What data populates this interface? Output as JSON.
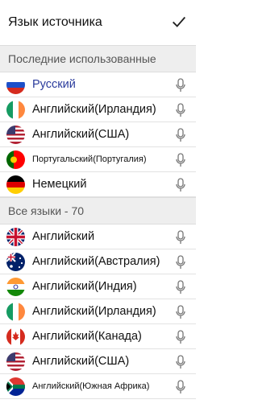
{
  "header": {
    "title": "Язык источника",
    "confirm_icon": "checkmark-icon"
  },
  "recent": {
    "heading": "Последние использованные",
    "items": [
      {
        "label": "Русский",
        "flag": "russia-flag-icon",
        "selected": true
      },
      {
        "label": "Английский(Ирландия)",
        "flag": "ireland-flag-icon"
      },
      {
        "label": "Английский(США)",
        "flag": "usa-flag-icon"
      },
      {
        "label": "Португальский(Португалия)",
        "flag": "portugal-flag-icon"
      },
      {
        "label": "Немецкий",
        "flag": "germany-flag-icon"
      }
    ]
  },
  "all": {
    "heading": "Все языки - 70",
    "items": [
      {
        "label": "Английский",
        "flag": "uk-flag-icon"
      },
      {
        "label": "Английский(Австралия)",
        "flag": "australia-flag-icon"
      },
      {
        "label": "Английский(Индия)",
        "flag": "india-flag-icon"
      },
      {
        "label": "Английский(Ирландия)",
        "flag": "ireland-flag-icon"
      },
      {
        "label": "Английский(Канада)",
        "flag": "canada-flag-icon"
      },
      {
        "label": "Английский(США)",
        "flag": "usa-flag-icon"
      },
      {
        "label": "Английский(Южная Африка)",
        "flag": "south-africa-flag-icon"
      }
    ]
  },
  "colors": {
    "selected_text": "#2a3b9c",
    "section_bg": "#eeeeee"
  },
  "mic_icon": "microphone-icon"
}
